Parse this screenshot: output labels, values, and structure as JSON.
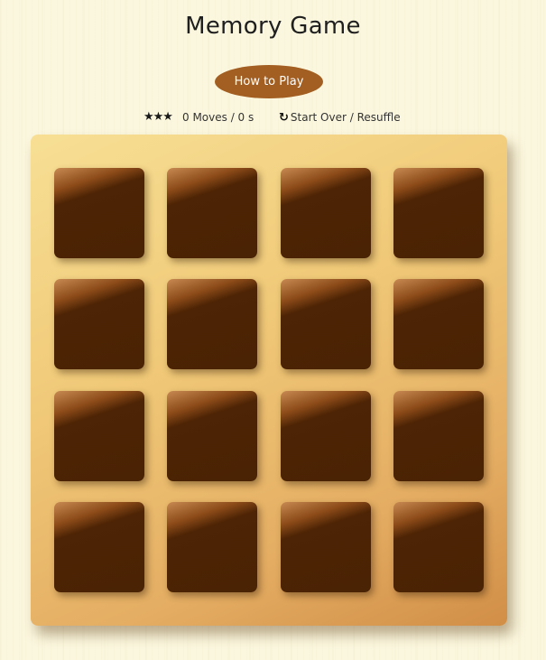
{
  "header": {
    "title": "Memory Game",
    "how_to_play_label": "How to Play"
  },
  "score_panel": {
    "stars": "★★★",
    "star_count": 3,
    "moves_text": "0 Moves / 0 s",
    "restart_icon": "↻",
    "restart_label": "Start Over / Resuffle"
  },
  "deck": {
    "rows": 4,
    "columns": 4,
    "cards_face_down": 16,
    "colors": {
      "card_back": "#4a2304",
      "button": "#a35f22",
      "board": "#f0c978",
      "page_background": "#fbf7de"
    }
  }
}
